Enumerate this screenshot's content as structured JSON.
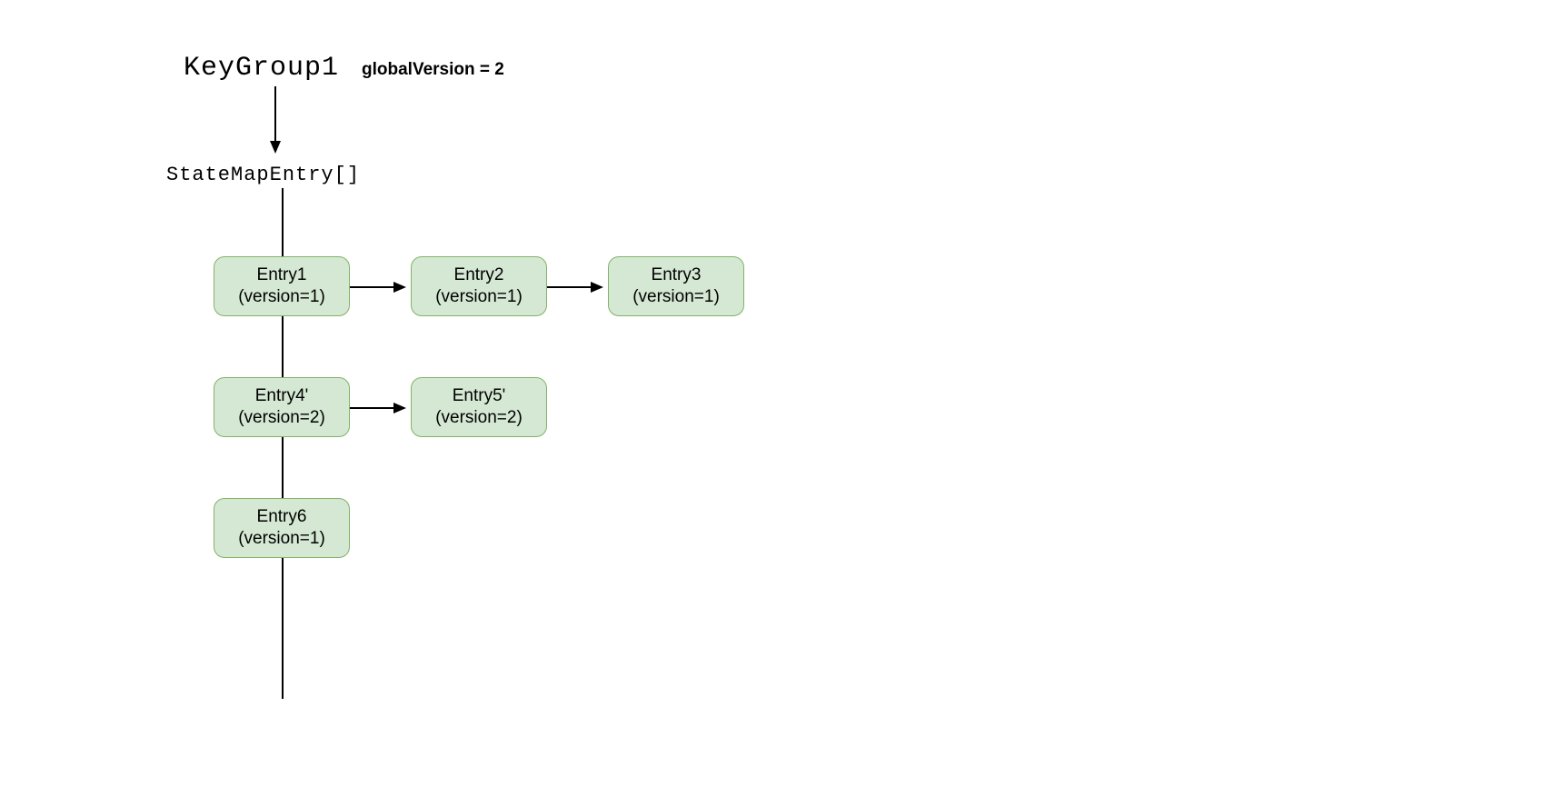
{
  "header": {
    "title": "KeyGroup1",
    "globalVersionLabel": "globalVersion = 2",
    "arrayLabel": "StateMapEntry[]"
  },
  "entries": {
    "e1": {
      "name": "Entry1",
      "version": "(version=1)"
    },
    "e2": {
      "name": "Entry2",
      "version": "(version=1)"
    },
    "e3": {
      "name": "Entry3",
      "version": "(version=1)"
    },
    "e4": {
      "name": "Entry4'",
      "version": "(version=2)"
    },
    "e5": {
      "name": "Entry5'",
      "version": "(version=2)"
    },
    "e6": {
      "name": "Entry6",
      "version": "(version=1)"
    }
  }
}
